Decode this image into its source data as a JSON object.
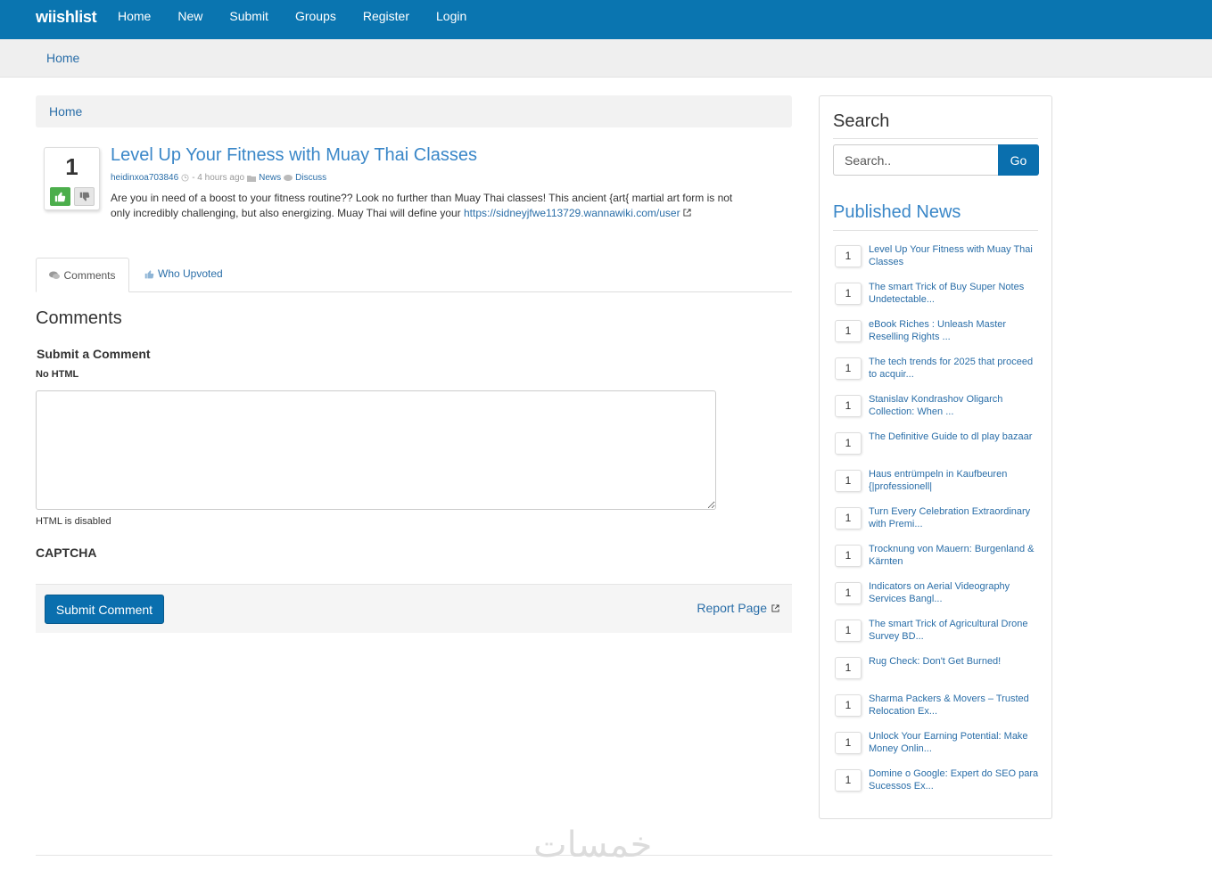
{
  "nav": {
    "brand": "wiishlist",
    "links": [
      "Home",
      "New",
      "Submit",
      "Groups",
      "Register",
      "Login"
    ]
  },
  "subbar": {
    "home": "Home"
  },
  "breadcrumb": {
    "home": "Home"
  },
  "post": {
    "votes": "1",
    "title": "Level Up Your Fitness with Muay Thai Classes",
    "author": "heidinxoa703846",
    "time": "- 4 hours ago",
    "category": "News",
    "discuss": "Discuss",
    "body": "Are you in need of a boost to your fitness routine?? Look no further than Muay Thai classes! This ancient {art{ martial art form is not only incredibly challenging, but also energizing. Muay Thai will define your ",
    "link": "https://sidneyjfwe113729.wannawiki.com/user"
  },
  "tabs": {
    "comments": "Comments",
    "upvoted": "Who Upvoted"
  },
  "comments": {
    "heading": "Comments",
    "submit_heading": "Submit a Comment",
    "no_html": "No HTML",
    "html_disabled": "HTML is disabled",
    "captcha": "CAPTCHA",
    "submit_label": "Submit Comment",
    "report_label": "Report Page"
  },
  "sidebar": {
    "search_heading": "Search",
    "search_placeholder": "Search..",
    "go_label": "Go",
    "published_heading": "Published News",
    "news": [
      {
        "count": "1",
        "title": "Level Up Your Fitness with Muay Thai Classes"
      },
      {
        "count": "1",
        "title": "The smart Trick of Buy Super Notes Undetectable..."
      },
      {
        "count": "1",
        "title": "eBook Riches : Unleash Master Reselling Rights ..."
      },
      {
        "count": "1",
        "title": "The tech trends for 2025 that proceed to acquir..."
      },
      {
        "count": "1",
        "title": "Stanislav Kondrashov Oligarch Collection: When ..."
      },
      {
        "count": "1",
        "title": "The Definitive Guide to dl play bazaar"
      },
      {
        "count": "1",
        "title": "Haus entrümpeln in Kaufbeuren {|professionell|"
      },
      {
        "count": "1",
        "title": "Turn Every Celebration Extraordinary with Premi..."
      },
      {
        "count": "1",
        "title": "Trocknung von Mauern: Burgenland & Kärnten"
      },
      {
        "count": "1",
        "title": "Indicators on Aerial Videography Services Bangl..."
      },
      {
        "count": "1",
        "title": "The smart Trick of Agricultural Drone Survey BD..."
      },
      {
        "count": "1",
        "title": "Rug Check: Don't Get Burned!"
      },
      {
        "count": "1",
        "title": "Sharma Packers & Movers – Trusted Relocation Ex..."
      },
      {
        "count": "1",
        "title": "Unlock Your Earning Potential: Make Money Onlin..."
      },
      {
        "count": "1",
        "title": "Domine o Google: Expert do SEO para Sucessos Ex..."
      }
    ]
  },
  "watermark": "خمسات"
}
